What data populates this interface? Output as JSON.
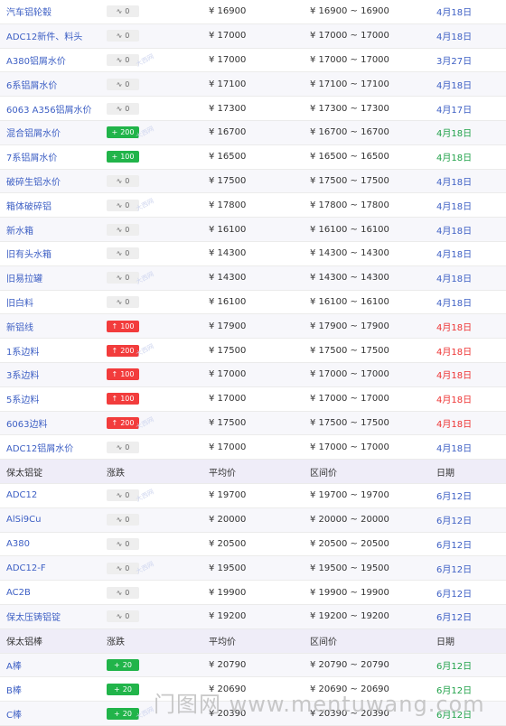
{
  "rows": [
    {
      "type": "data",
      "name": "汽车铝轮毂",
      "dir": "flat",
      "chg": "0",
      "avg": "¥ 16900",
      "range": "¥ 16900 ~ 16900",
      "date": "4月18日",
      "date_color": "blue"
    },
    {
      "type": "data",
      "name": "ADC12新件、料头",
      "dir": "flat",
      "chg": "0",
      "avg": "¥ 17000",
      "range": "¥ 17000 ~ 17000",
      "date": "4月18日",
      "date_color": "blue"
    },
    {
      "type": "data",
      "name": "A380铝屑水价",
      "dir": "flat",
      "chg": "0",
      "avg": "¥ 17000",
      "range": "¥ 17000 ~ 17000",
      "date": "3月27日",
      "date_color": "blue"
    },
    {
      "type": "data",
      "name": "6系铝屑水价",
      "dir": "flat",
      "chg": "0",
      "avg": "¥ 17100",
      "range": "¥ 17100 ~ 17100",
      "date": "4月18日",
      "date_color": "blue"
    },
    {
      "type": "data",
      "name": "6063 A356铝屑水价",
      "dir": "flat",
      "chg": "0",
      "avg": "¥ 17300",
      "range": "¥ 17300 ~ 17300",
      "date": "4月17日",
      "date_color": "blue"
    },
    {
      "type": "data",
      "name": "混合铝屑水价",
      "dir": "down",
      "chg": "200",
      "avg": "¥ 16700",
      "range": "¥ 16700 ~ 16700",
      "date": "4月18日",
      "date_color": "green"
    },
    {
      "type": "data",
      "name": "7系铝屑水价",
      "dir": "down",
      "chg": "100",
      "avg": "¥ 16500",
      "range": "¥ 16500 ~ 16500",
      "date": "4月18日",
      "date_color": "green"
    },
    {
      "type": "data",
      "name": "破碎生铝水价",
      "dir": "flat",
      "chg": "0",
      "avg": "¥ 17500",
      "range": "¥ 17500 ~ 17500",
      "date": "4月18日",
      "date_color": "blue"
    },
    {
      "type": "data",
      "name": "箱体破碎铝",
      "dir": "flat",
      "chg": "0",
      "avg": "¥ 17800",
      "range": "¥ 17800 ~ 17800",
      "date": "4月18日",
      "date_color": "blue"
    },
    {
      "type": "data",
      "name": "新水箱",
      "dir": "flat",
      "chg": "0",
      "avg": "¥ 16100",
      "range": "¥ 16100 ~ 16100",
      "date": "4月18日",
      "date_color": "blue"
    },
    {
      "type": "data",
      "name": "旧有头水箱",
      "dir": "flat",
      "chg": "0",
      "avg": "¥ 14300",
      "range": "¥ 14300 ~ 14300",
      "date": "4月18日",
      "date_color": "blue"
    },
    {
      "type": "data",
      "name": "旧易拉罐",
      "dir": "flat",
      "chg": "0",
      "avg": "¥ 14300",
      "range": "¥ 14300 ~ 14300",
      "date": "4月18日",
      "date_color": "blue"
    },
    {
      "type": "data",
      "name": "旧白料",
      "dir": "flat",
      "chg": "0",
      "avg": "¥ 16100",
      "range": "¥ 16100 ~ 16100",
      "date": "4月18日",
      "date_color": "blue"
    },
    {
      "type": "data",
      "name": "新铝线",
      "dir": "up",
      "chg": "100",
      "avg": "¥ 17900",
      "range": "¥ 17900 ~ 17900",
      "date": "4月18日",
      "date_color": "red"
    },
    {
      "type": "data",
      "name": "1系边料",
      "dir": "up",
      "chg": "200",
      "avg": "¥ 17500",
      "range": "¥ 17500 ~ 17500",
      "date": "4月18日",
      "date_color": "red"
    },
    {
      "type": "data",
      "name": "3系边料",
      "dir": "up",
      "chg": "100",
      "avg": "¥ 17000",
      "range": "¥ 17000 ~ 17000",
      "date": "4月18日",
      "date_color": "red"
    },
    {
      "type": "data",
      "name": "5系边料",
      "dir": "up",
      "chg": "100",
      "avg": "¥ 17000",
      "range": "¥ 17000 ~ 17000",
      "date": "4月18日",
      "date_color": "red"
    },
    {
      "type": "data",
      "name": "6063边料",
      "dir": "up",
      "chg": "200",
      "avg": "¥ 17500",
      "range": "¥ 17500 ~ 17500",
      "date": "4月18日",
      "date_color": "red"
    },
    {
      "type": "data",
      "name": "ADC12铝屑水价",
      "dir": "flat",
      "chg": "0",
      "avg": "¥ 17000",
      "range": "¥ 17000 ~ 17000",
      "date": "4月18日",
      "date_color": "blue"
    },
    {
      "type": "header",
      "name": "保太铝锭",
      "chg": "涨跌",
      "avg": "平均价",
      "range": "区间价",
      "date": "日期"
    },
    {
      "type": "data",
      "name": "ADC12",
      "dir": "flat",
      "chg": "0",
      "avg": "¥ 19700",
      "range": "¥ 19700 ~ 19700",
      "date": "6月12日",
      "date_color": "blue"
    },
    {
      "type": "data",
      "name": "AlSi9Cu",
      "dir": "flat",
      "chg": "0",
      "avg": "¥ 20000",
      "range": "¥ 20000 ~ 20000",
      "date": "6月12日",
      "date_color": "blue"
    },
    {
      "type": "data",
      "name": "A380",
      "dir": "flat",
      "chg": "0",
      "avg": "¥ 20500",
      "range": "¥ 20500 ~ 20500",
      "date": "6月12日",
      "date_color": "blue"
    },
    {
      "type": "data",
      "name": "ADC12-F",
      "dir": "flat",
      "chg": "0",
      "avg": "¥ 19500",
      "range": "¥ 19500 ~ 19500",
      "date": "6月12日",
      "date_color": "blue"
    },
    {
      "type": "data",
      "name": "AC2B",
      "dir": "flat",
      "chg": "0",
      "avg": "¥ 19900",
      "range": "¥ 19900 ~ 19900",
      "date": "6月12日",
      "date_color": "blue"
    },
    {
      "type": "data",
      "name": "保太压铸铝锭",
      "dir": "flat",
      "chg": "0",
      "avg": "¥ 19200",
      "range": "¥ 19200 ~ 19200",
      "date": "6月12日",
      "date_color": "blue"
    },
    {
      "type": "header",
      "name": "保太铝棒",
      "chg": "涨跌",
      "avg": "平均价",
      "range": "区间价",
      "date": "日期"
    },
    {
      "type": "data",
      "name": "A棒",
      "dir": "down",
      "chg": "20",
      "avg": "¥ 20790",
      "range": "¥ 20790 ~ 20790",
      "date": "6月12日",
      "date_color": "green"
    },
    {
      "type": "data",
      "name": "B棒",
      "dir": "down",
      "chg": "20",
      "avg": "¥ 20690",
      "range": "¥ 20690 ~ 20690",
      "date": "6月12日",
      "date_color": "green"
    },
    {
      "type": "data",
      "name": "C棒",
      "dir": "down",
      "chg": "20",
      "avg": "¥ 20390",
      "range": "¥ 20390 ~ 20390",
      "date": "6月12日",
      "date_color": "green"
    }
  ],
  "icons": {
    "flat": "flat-trend-icon",
    "up": "up-arrow-icon",
    "down": "down-arrow-icon"
  },
  "colors": {
    "link": "#3d5fc4",
    "up": "#f23c3c",
    "down": "#21b44a",
    "header_bg": "#efedf8"
  },
  "watermark": {
    "row": "大西网",
    "footer": "门图网 www.mentuwang.com"
  }
}
